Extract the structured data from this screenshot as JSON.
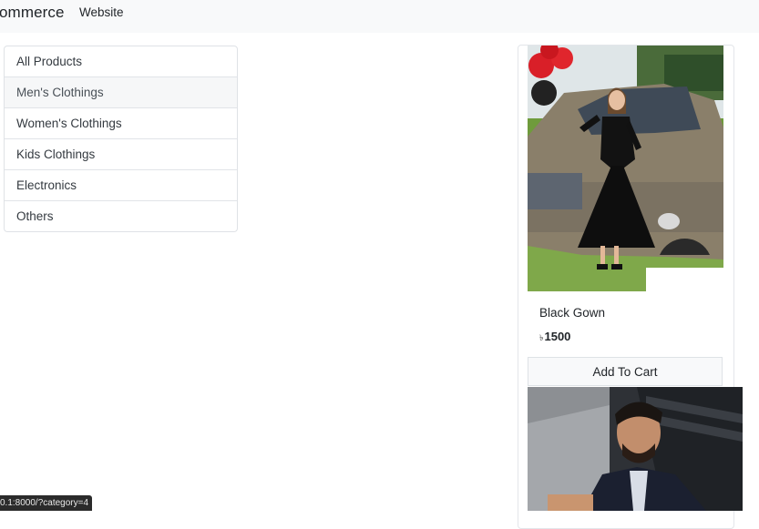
{
  "navbar": {
    "brand": "ommerce",
    "links": [
      "Website"
    ]
  },
  "categories": {
    "items": [
      "All Products",
      "Men's Clothings",
      "Women's Clothings",
      "Kids Clothings",
      "Electronics",
      "Others"
    ],
    "hovered_index": 1
  },
  "product": {
    "title": "Black Gown",
    "currency": "৳",
    "price": "1500",
    "button_label": "Add To Cart"
  },
  "status_bar": {
    "url": "0.1:8000/?category=4"
  }
}
